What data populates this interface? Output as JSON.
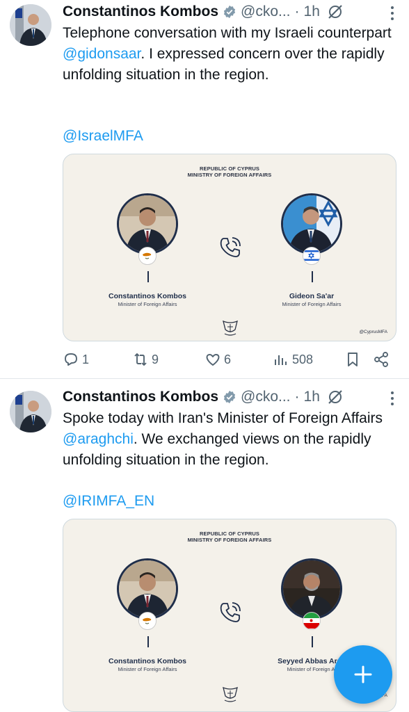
{
  "tweets": [
    {
      "author_name": "Constantinos Kombos",
      "handle": "@cko...",
      "separator": "·",
      "time": "1h",
      "text_before": "Telephone conversation with my Israeli counterpart ",
      "mention": "@gidonsaar",
      "text_after": ". I expressed concern over the rapidly unfolding situation in the region.",
      "tag": "@IsraelMFA",
      "card": {
        "header_line1": "REPUBLIC OF CYPRUS",
        "header_line2": "MINISTRY OF FOREIGN AFFAIRS",
        "left_name": "Constantinos Kombos",
        "left_role": "Minister of Foreign Affairs",
        "right_name": "Gideon Sa'ar",
        "right_role": "Minister of Foreign Affairs",
        "watermark": "@CyprusMFA",
        "right_flag": "israel-flag"
      },
      "actions": {
        "replies": "1",
        "reposts": "9",
        "likes": "6",
        "views": "508"
      }
    },
    {
      "author_name": "Constantinos Kombos",
      "handle": "@cko...",
      "separator": "·",
      "time": "1h",
      "text_before": "Spoke today with Iran's Minister of Foreign Affairs ",
      "mention": "@araghchi",
      "text_after": ". We exchanged views on the rapidly unfolding situation in the region.",
      "tag": "@IRIMFA_EN",
      "card": {
        "header_line1": "REPUBLIC OF CYPRUS",
        "header_line2": "MINISTRY OF FOREIGN AFFAIRS",
        "left_name": "Constantinos Kombos",
        "left_role": "Minister of Foreign Affairs",
        "right_name": "Seyyed Abbas Arag",
        "right_role": "Minister of Foreign Af",
        "watermark": "FA",
        "right_flag": "iran-flag"
      }
    }
  ],
  "colors": {
    "accent": "#1d9bf0",
    "text_primary": "#0f1419",
    "text_secondary": "#536471",
    "card_background": "#f4f1ea",
    "card_navy": "#1f2e4a"
  },
  "icons": {
    "verified": "verified-badge-icon",
    "grok": "grok-icon",
    "more": "more-vertical-icon",
    "reply": "reply-icon",
    "repost": "repost-icon",
    "like": "heart-icon",
    "views": "views-chart-icon",
    "bookmark": "bookmark-icon",
    "share": "share-icon",
    "compose": "plus-icon"
  }
}
